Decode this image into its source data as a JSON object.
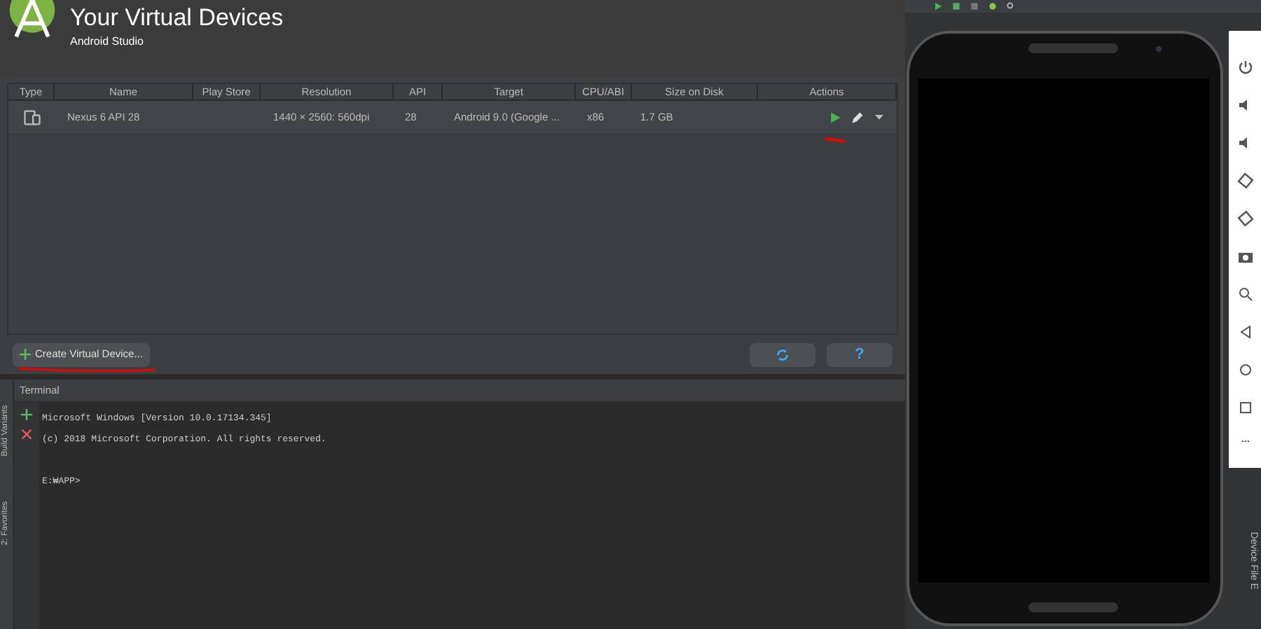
{
  "header": {
    "title": "Your Virtual Devices",
    "subtitle": "Android Studio"
  },
  "table": {
    "columns": [
      "Type",
      "Name",
      "Play Store",
      "Resolution",
      "API",
      "Target",
      "CPU/ABI",
      "Size on Disk",
      "Actions"
    ],
    "rows": [
      {
        "name": "Nexus 6 API 28",
        "resolution": "1440 × 2560: 560dpi",
        "api": "28",
        "target": "Android 9.0 (Google ...",
        "cpu": "x86",
        "size": "1.7 GB"
      }
    ]
  },
  "footer": {
    "create_button": "Create Virtual Device...",
    "help_button": "?"
  },
  "side_tabs": [
    "Build Variants",
    "2: Favorites"
  ],
  "terminal": {
    "title": "Terminal",
    "lines": [
      "Microsoft Windows [Version 10.0.17134.345]",
      "(c) 2018 Microsoft Corporation. All rights reserved."
    ],
    "prompt": "E:₩APP>"
  },
  "right_tab": "Device File E"
}
